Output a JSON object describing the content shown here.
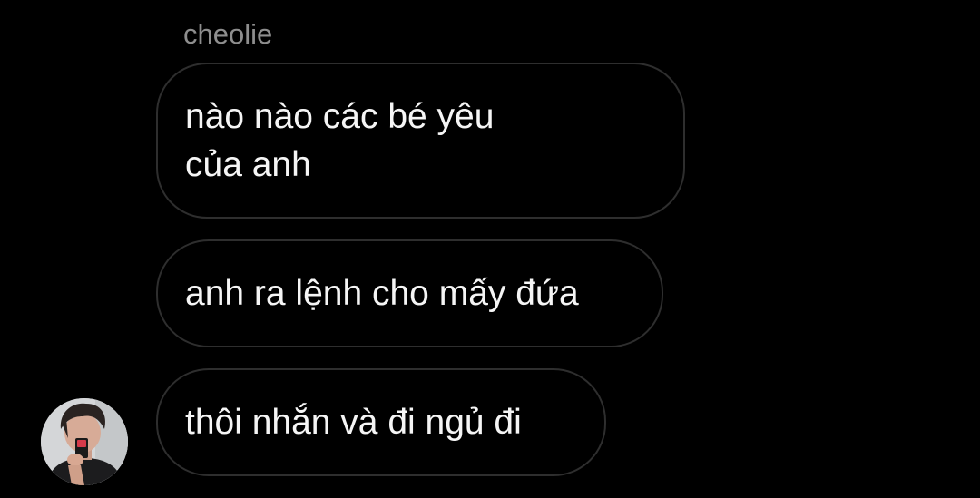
{
  "thread": {
    "sender_name": "cheolie",
    "messages": [
      {
        "text": "nào nào các bé yêu của anh"
      },
      {
        "text": "anh ra lệnh cho mấy đứa"
      },
      {
        "text": "thôi nhắn và đi ngủ đi"
      }
    ],
    "avatar": {
      "icon": "user-avatar-photo"
    }
  },
  "colors": {
    "background": "#000000",
    "bubble_border": "#2e2e2e",
    "bubble_text": "#f5f5f5",
    "sender_text": "#8e8e8e"
  }
}
